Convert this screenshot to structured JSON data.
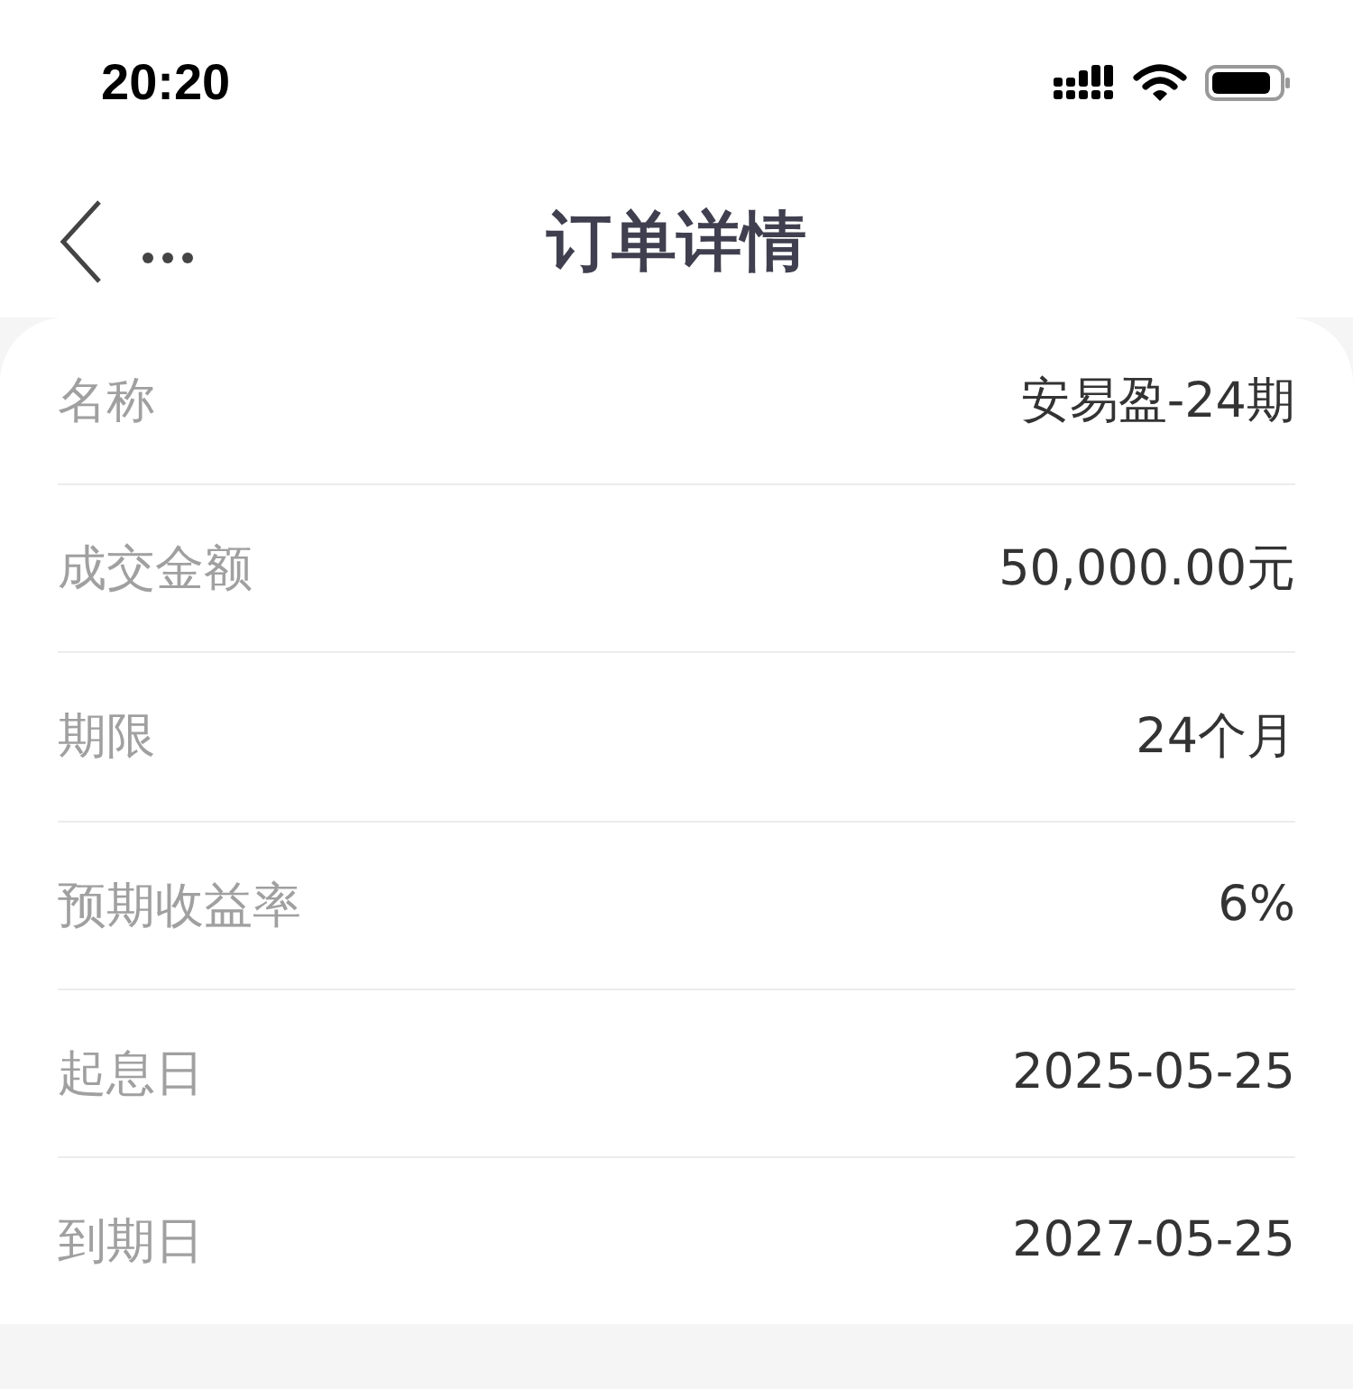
{
  "status_bar": {
    "time": "20:20"
  },
  "nav": {
    "title": "订单详情"
  },
  "details": [
    {
      "label": "名称",
      "value": "安易盈-24期"
    },
    {
      "label": "成交金额",
      "value": "50,000.00元"
    },
    {
      "label": "期限",
      "value": "24个月"
    },
    {
      "label": "预期收益率",
      "value": "6%"
    },
    {
      "label": "起息日",
      "value": "2025-05-25"
    },
    {
      "label": "到期日",
      "value": "2027-05-25"
    }
  ]
}
